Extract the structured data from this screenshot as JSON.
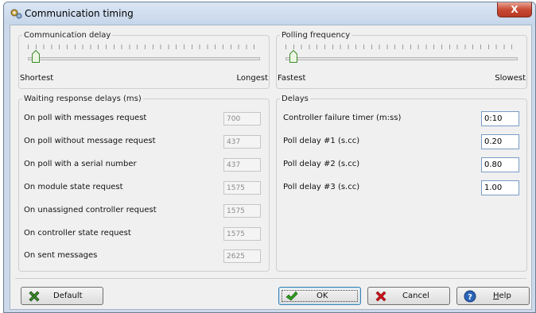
{
  "window": {
    "title": "Communication timing",
    "close_glyph": "X"
  },
  "communication_delay": {
    "legend": "Communication delay",
    "min_label": "Shortest",
    "max_label": "Longest",
    "value_fraction": 0.0
  },
  "polling_frequency": {
    "legend": "Polling frequency",
    "min_label": "Fastest",
    "max_label": "Slowest",
    "value_fraction": 0.0
  },
  "waiting": {
    "legend": "Waiting response delays (ms)",
    "rows": [
      {
        "label": "On poll with messages request",
        "value": "700"
      },
      {
        "label": "On poll without message request",
        "value": "437"
      },
      {
        "label": "On poll with a serial number",
        "value": "437"
      },
      {
        "label": "On module state request",
        "value": "1575"
      },
      {
        "label": "On unassigned controller request",
        "value": "1575"
      },
      {
        "label": "On controller state request",
        "value": "1575"
      },
      {
        "label": "On sent messages",
        "value": "2625"
      }
    ]
  },
  "delays": {
    "legend": "Delays",
    "rows": [
      {
        "label": "Controller failure timer (m:ss)",
        "value": "0:10"
      },
      {
        "label": "Poll delay #1 (s.cc)",
        "value": "0.20"
      },
      {
        "label": "Poll delay #2 (s.cc)",
        "value": "0.80"
      },
      {
        "label": "Poll delay #3 (s.cc)",
        "value": "1.00"
      }
    ]
  },
  "buttons": {
    "default": {
      "label": "Default",
      "icon": "tools-icon"
    },
    "ok": {
      "label": "OK",
      "icon": "checkmark-icon"
    },
    "cancel": {
      "label": "Cancel",
      "icon": "red-x-icon"
    },
    "help": {
      "label_prefix": "",
      "label_underlined": "H",
      "label_rest": "elp",
      "icon": "help-icon"
    }
  },
  "colors": {
    "accent": "#3c7fb1",
    "close": "#c84b35",
    "ok_check": "#2f9a1e",
    "cancel_x": "#d0121b"
  }
}
